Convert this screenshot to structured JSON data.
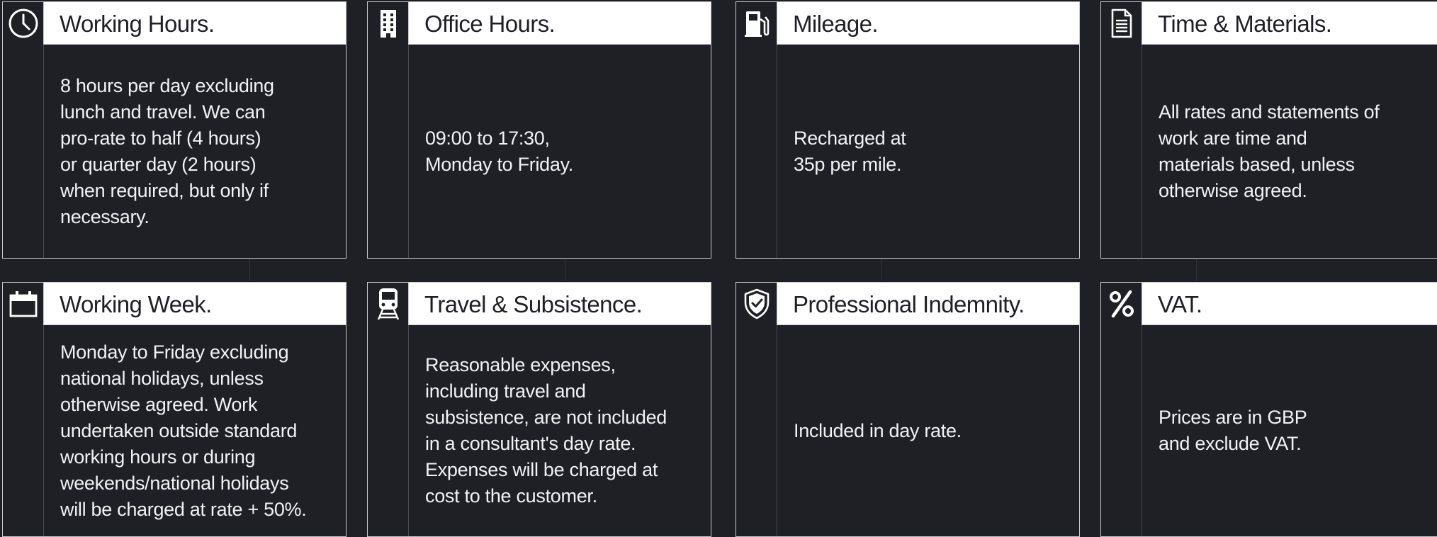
{
  "cards": [
    {
      "title": "Working Hours.",
      "icon": "clock-icon",
      "text": "8 hours per day excluding\nlunch and travel. We can\npro-rate to half (4 hours)\nor quarter day (2 hours)\nwhen required, but only if\nnecessary."
    },
    {
      "title": "Office Hours.",
      "icon": "building-icon",
      "text": "09:00 to 17:30,\nMonday to Friday."
    },
    {
      "title": "Mileage.",
      "icon": "fuel-pump-icon",
      "text": "Recharged at\n35p per mile."
    },
    {
      "title": "Time & Materials.",
      "icon": "document-icon",
      "text": "All rates and statements of\nwork are time and\nmaterials based, unless\notherwise agreed."
    },
    {
      "title": "Working Week.",
      "icon": "calendar-icon",
      "text": "Monday to Friday excluding\nnational holidays, unless\notherwise agreed. Work\nundertaken outside standard\nworking hours or during\nweekends/national holidays\nwill be charged at rate + 50%."
    },
    {
      "title": "Travel & Subsistence.",
      "icon": "train-icon",
      "text": "Reasonable expenses,\nincluding travel and\nsubsistence, are not included\nin a consultant's day rate.\nExpenses will be charged at\ncost to the customer."
    },
    {
      "title": "Professional Indemnity.",
      "icon": "shield-check-icon",
      "text": "Included in day rate."
    },
    {
      "title": "VAT.",
      "icon": "percent-icon",
      "text": "Prices are in GBP\nand exclude VAT."
    }
  ],
  "colors": {
    "background": "#1f1f26",
    "header": "#ffffff",
    "text": "#f2f2f4",
    "border": "#c9c9cf"
  }
}
